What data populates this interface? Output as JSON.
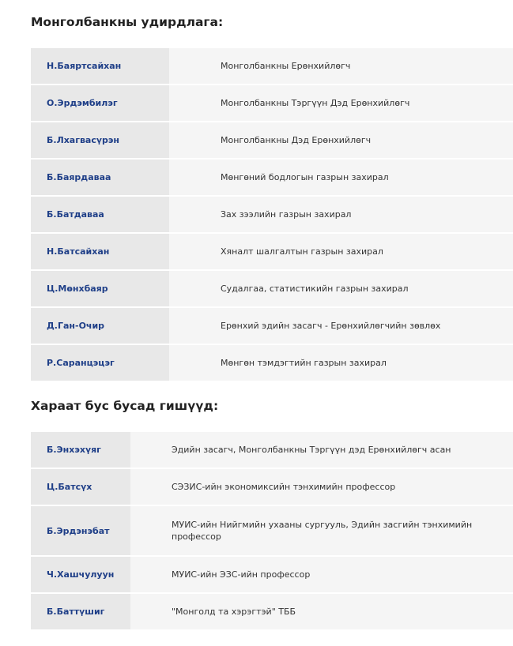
{
  "management": {
    "title": "Монголбанкны удирдлага:",
    "rows": [
      {
        "name": "Н.Баяртсайхан",
        "position": "Монголбанкны Ерөнхийлөгч"
      },
      {
        "name": "О.Эрдэмбилэг",
        "position": "Монголбанкны Тэргүүн Дэд Ерөнхийлөгч"
      },
      {
        "name": "Б.Лхагвасүрэн",
        "position": "Монголбанкны Дэд Ерөнхийлөгч"
      },
      {
        "name": "Б.Баярдаваа",
        "position": "Мөнгөний бодлогын газрын захирал"
      },
      {
        "name": "Б.Батдаваа",
        "position": "Зах зээлийн газрын захирал"
      },
      {
        "name": "Н.Батсайхан",
        "position": "Хяналт шалгалтын газрын захирал"
      },
      {
        "name": "Ц.Мөнхбаяр",
        "position": "Судалгаа, статистикийн газрын захирал"
      },
      {
        "name": "Д.Ган-Очир",
        "position": "Ерөнхий эдийн засагч - Ерөнхийлөгчийн зөвлөх"
      },
      {
        "name": "Р.Саранцэцэг",
        "position": "Мөнгөн тэмдэгтийн газрын захирал"
      }
    ]
  },
  "other_members": {
    "title": "Хараат бус бусад гишүүд:",
    "rows": [
      {
        "name": "Б.Энхэхүяг",
        "position": "Эдийн засагч, Монголбанкны Тэргүүн дэд Ерөнхийлөгч асан"
      },
      {
        "name": "Ц.Батсүх",
        "position": "СЭЗИС-ийн экономиксийн тэнхимийн профессор"
      },
      {
        "name": "Б.Эрдэнэбат",
        "position": "МУИС-ийн Нийгмийн ухааны сургууль, Эдийн засгийн тэнхимийн профессор"
      },
      {
        "name": "Ч.Хашчулуун",
        "position": "МУИС-ийн ЭЗС-ийн профессор"
      },
      {
        "name": "Б.Баттүшиг",
        "position": "\"Монголд та хэрэгтэй\" ТББ"
      }
    ]
  },
  "colors": {
    "name_text": "#1f3f88",
    "name_bg": "#e8e8e8",
    "position_bg": "#f5f5f5"
  }
}
